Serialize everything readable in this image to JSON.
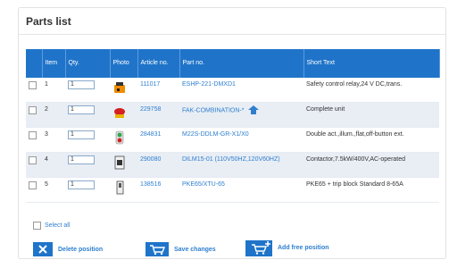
{
  "panel": {
    "title": "Parts list"
  },
  "table": {
    "columns": [
      "",
      "Item",
      "Qty.",
      "Photo",
      "Article no.",
      "Part no.",
      "Short Text"
    ],
    "rows": [
      {
        "item": "1",
        "qty": "1",
        "photo": "orange-relay-photo",
        "article": "111017",
        "part": "ESHP-221-DMXD1",
        "text": "Safety control relay,24 V DC,trans."
      },
      {
        "item": "2",
        "qty": "1",
        "photo": "red-mushroom-button-photo",
        "article": "229758",
        "part": "FAK-COMBINATION-*",
        "text": "Complete unit"
      },
      {
        "item": "3",
        "qty": "1",
        "photo": "green-pushbutton-photo",
        "article": "284831",
        "part": "M22S-DDLM-GR-X1/X0",
        "text": "Double act.,illum.,flat,off-button ext."
      },
      {
        "item": "4",
        "qty": "1",
        "photo": "contactor-photo",
        "article": "290080",
        "part": "DILM15-01 (110V50HZ,120V60HZ)",
        "text": "Contactor,7.5kW/400V,AC-operated"
      },
      {
        "item": "5",
        "qty": "1",
        "photo": "trip-block-photo",
        "article": "138516",
        "part": "PKE65/XTU-65",
        "text": "PKE65 + trip block Standard 8-65A"
      }
    ]
  },
  "select_all_label": "Select all",
  "actions": {
    "delete": "Delete position",
    "save": "Save changes",
    "add": "Add free position"
  },
  "colors": {
    "header": "#1f74c9",
    "link": "#2f7fcf",
    "alt_row": "#e9eef5"
  }
}
